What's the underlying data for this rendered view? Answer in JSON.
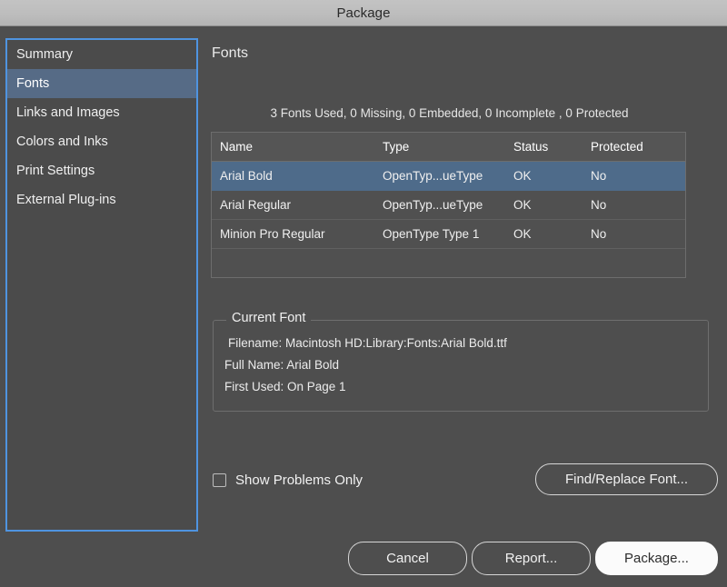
{
  "window": {
    "title": "Package"
  },
  "sidebar": {
    "items": [
      {
        "label": "Summary"
      },
      {
        "label": "Fonts"
      },
      {
        "label": "Links and Images"
      },
      {
        "label": "Colors and Inks"
      },
      {
        "label": "Print Settings"
      },
      {
        "label": "External Plug-ins"
      }
    ],
    "selected_index": 1,
    "focus_ring_color": "#4f94e0",
    "selected_color": "#566b86"
  },
  "main": {
    "section_title": "Fonts",
    "summary_line": "3 Fonts Used, 0 Missing, 0 Embedded, 0 Incomplete , 0 Protected",
    "table": {
      "columns": [
        "Name",
        "Type",
        "Status",
        "Protected"
      ],
      "rows": [
        {
          "name": "Arial Bold",
          "type": "OpenTyp...ueType",
          "status": "OK",
          "protected": "No"
        },
        {
          "name": "Arial Regular",
          "type": "OpenTyp...ueType",
          "status": "OK",
          "protected": "No"
        },
        {
          "name": "Minion Pro Regular",
          "type": "OpenType Type 1",
          "status": "OK",
          "protected": "No"
        }
      ],
      "selected_row_index": 0,
      "selected_row_color": "#4e6b8a"
    },
    "current_font": {
      "legend": "Current Font",
      "filename": "Filename: Macintosh HD:Library:Fonts:Arial Bold.ttf",
      "full_name": "Full Name: Arial Bold",
      "first_used": "First Used: On Page 1"
    },
    "show_problems_only": {
      "label": "Show Problems Only",
      "checked": false
    },
    "find_replace_button": "Find/Replace Font..."
  },
  "footer": {
    "cancel": "Cancel",
    "report": "Report...",
    "package": "Package..."
  }
}
